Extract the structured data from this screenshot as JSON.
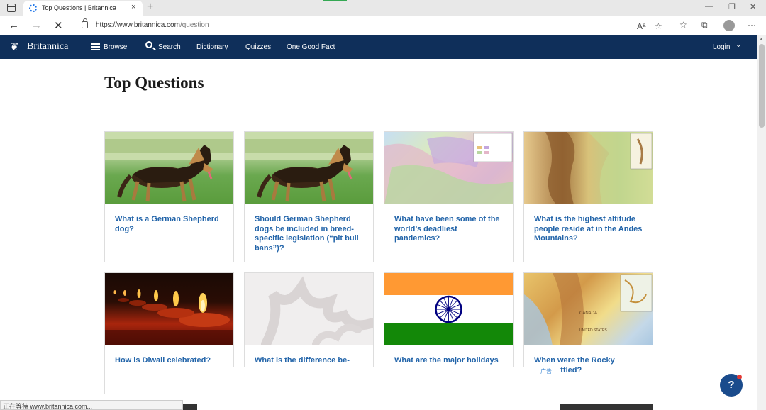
{
  "browser": {
    "tab_title": "Top Questions | Britannica",
    "tab_close": "×",
    "new_tab": "+",
    "url_host": "https://www.britannica.com",
    "url_path": "/question",
    "status_text": "正在等待 www.britannica.com..."
  },
  "sitenav": {
    "logo": "Britannica",
    "items": [
      "Browse",
      "Search",
      "Dictionary",
      "Quizzes",
      "One Good Fact"
    ],
    "login": "Login"
  },
  "page": {
    "title": "Top Questions"
  },
  "cards": [
    {
      "question": "What is a German Shepherd dog?",
      "thumb": "german-shepherd"
    },
    {
      "question": "Should German Shepherd dogs be included in breed-specific legislation (“pit bull bans”)?",
      "thumb": "german-shepherd"
    },
    {
      "question": "What have been some of the world’s deadliest pandemics?",
      "thumb": "pandemic-map"
    },
    {
      "question": "What is the highest altitude people reside at in the Andes Mountains?",
      "thumb": "andes-map"
    },
    {
      "question": "How is Diwali celebrated?",
      "thumb": "diwali-lamps"
    },
    {
      "question": "What is the difference be-",
      "thumb": "placeholder"
    },
    {
      "question": "What are the major holidays",
      "thumb": "india-flag"
    },
    {
      "question": "When were the Rocky\nains settled?",
      "thumb": "rocky-map"
    }
  ],
  "ad": {
    "label": "广告"
  },
  "help": {
    "label": "?"
  },
  "colors": {
    "nav": "#0f2f5a",
    "link": "#2264a9",
    "flag_saffron": "#ff9933",
    "flag_green": "#138808",
    "chakra": "#000080"
  }
}
